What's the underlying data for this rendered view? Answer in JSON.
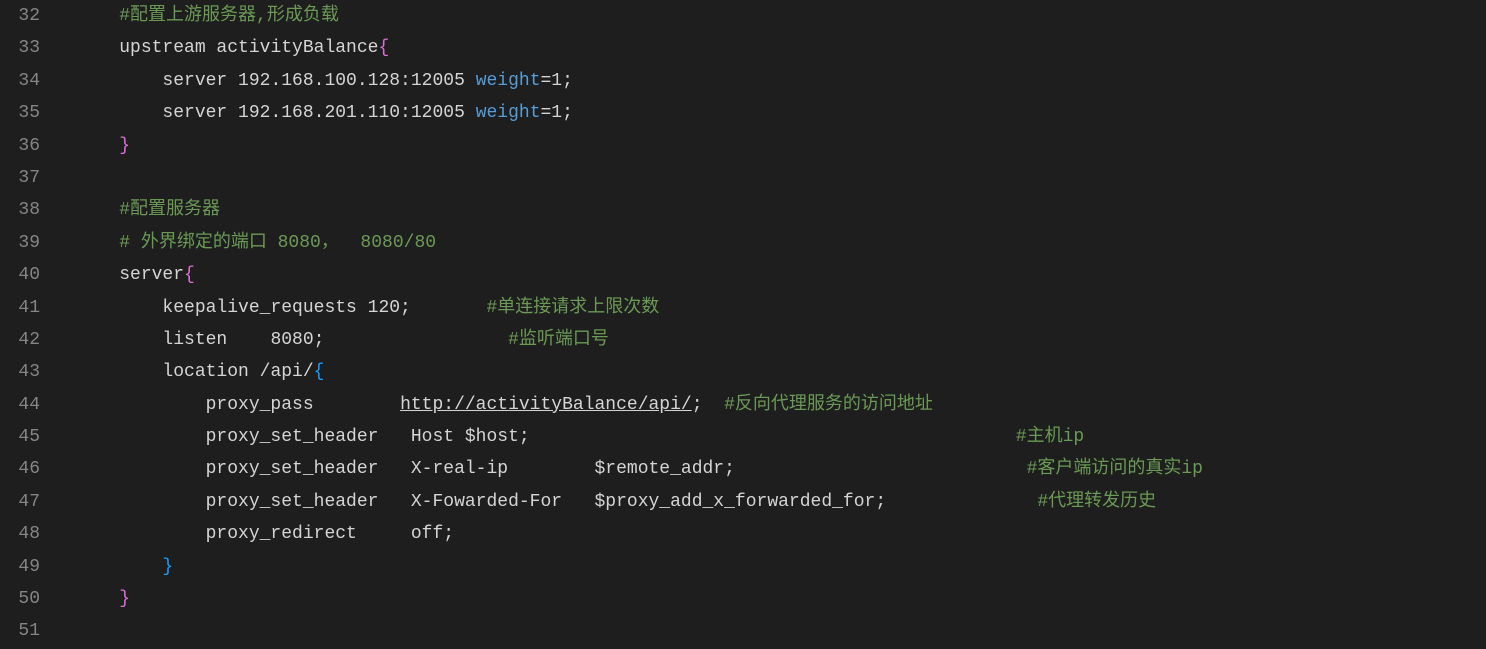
{
  "lineNumbers": [
    "32",
    "33",
    "34",
    "35",
    "36",
    "37",
    "38",
    "39",
    "40",
    "41",
    "42",
    "43",
    "44",
    "45",
    "46",
    "47",
    "48",
    "49",
    "50",
    "51"
  ],
  "lines": {
    "32": {
      "indent": "    ",
      "comment": "#配置上游服务器,形成负载"
    },
    "33": {
      "indent": "    ",
      "text1": "upstream activityBalance",
      "brace": "{"
    },
    "34": {
      "indent": "        ",
      "text1": "server 192.168.100.128:12005 ",
      "keyword": "weight",
      "text2": "=1;"
    },
    "35": {
      "indent": "        ",
      "text1": "server 192.168.201.110:12005 ",
      "keyword": "weight",
      "text2": "=1;"
    },
    "36": {
      "indent": "    ",
      "brace": "}"
    },
    "37": {
      "indent": ""
    },
    "38": {
      "indent": "    ",
      "comment": "#配置服务器"
    },
    "39": {
      "indent": "    ",
      "comment": "# 外界绑定的端口 8080，  8080/80"
    },
    "40": {
      "indent": "    ",
      "text1": "server",
      "brace": "{"
    },
    "41": {
      "indent": "        ",
      "text1": "keepalive_requests 120;       ",
      "comment": "#单连接请求上限次数"
    },
    "42": {
      "indent": "        ",
      "text1": "listen    8080;                 ",
      "comment": "#监听端口号"
    },
    "43": {
      "indent": "        ",
      "text1": "location /api/",
      "brace": "{"
    },
    "44": {
      "indent": "            ",
      "text1": "proxy_pass        ",
      "url": "http://activityBalance/api/",
      "text2": ";  ",
      "comment": "#反向代理服务的访问地址"
    },
    "45": {
      "indent": "            ",
      "text1": "proxy_set_header   Host $host;                                             ",
      "comment": "#主机ip"
    },
    "46": {
      "indent": "            ",
      "text1": "proxy_set_header   X-real-ip        $remote_addr;                           ",
      "comment": "#客户端访问的真实ip"
    },
    "47": {
      "indent": "            ",
      "text1": "proxy_set_header   X-Fowarded-For   $proxy_add_x_forwarded_for;              ",
      "comment": "#代理转发历史"
    },
    "48": {
      "indent": "            ",
      "text1": "proxy_redirect     off;"
    },
    "49": {
      "indent": "        ",
      "brace": "}"
    },
    "50": {
      "indent": "    ",
      "brace": "}"
    },
    "51": {
      "indent": ""
    }
  }
}
